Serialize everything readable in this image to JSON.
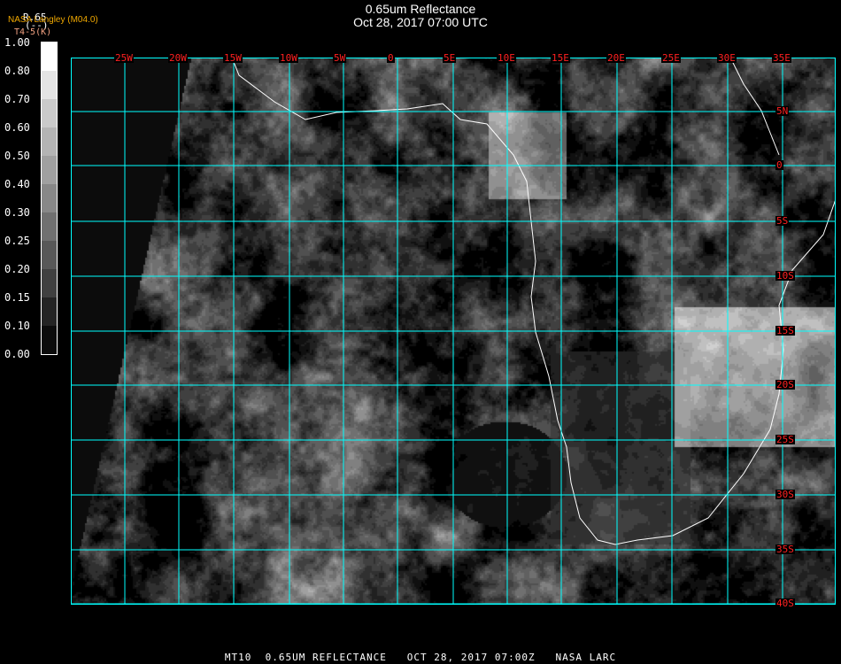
{
  "header": {
    "title": "0.65um Reflectance",
    "subtitle": "Oct 28, 2017 07:00 UTC",
    "organization": "NASA Langley (M04.0)",
    "product": "R.65",
    "product_units": "(--)",
    "secondary_units": "T4-5(K)"
  },
  "colorbar": {
    "labels": [
      "1.00",
      "0.80",
      "0.70",
      "0.60",
      "0.50",
      "0.40",
      "0.30",
      "0.25",
      "0.20",
      "0.15",
      "0.10",
      "0.00"
    ],
    "colors": [
      "#ffffff",
      "#e4e4e4",
      "#cacaca",
      "#b4b4b4",
      "#a0a0a0",
      "#888888",
      "#707070",
      "#585858",
      "#404040",
      "#242424",
      "#0c0c0c"
    ]
  },
  "map": {
    "grid_color": "#00ffff",
    "label_color": "#ff2020",
    "coast_color": "#ffffff",
    "longitude_labels": [
      "25W",
      "20W",
      "15W",
      "10W",
      "5W",
      "0",
      "5E",
      "10E",
      "15E",
      "20E",
      "25E",
      "30E",
      "35E"
    ],
    "latitude_labels": [
      "5N",
      "0",
      "5S",
      "10S",
      "15S",
      "20S",
      "25S",
      "30S",
      "35S",
      "40S"
    ]
  },
  "footer": {
    "satellite": "MT10",
    "product": "0.65UM REFLECTANCE",
    "datetime": "OCT 28, 2017 07:00Z",
    "source": "NASA LARC"
  }
}
